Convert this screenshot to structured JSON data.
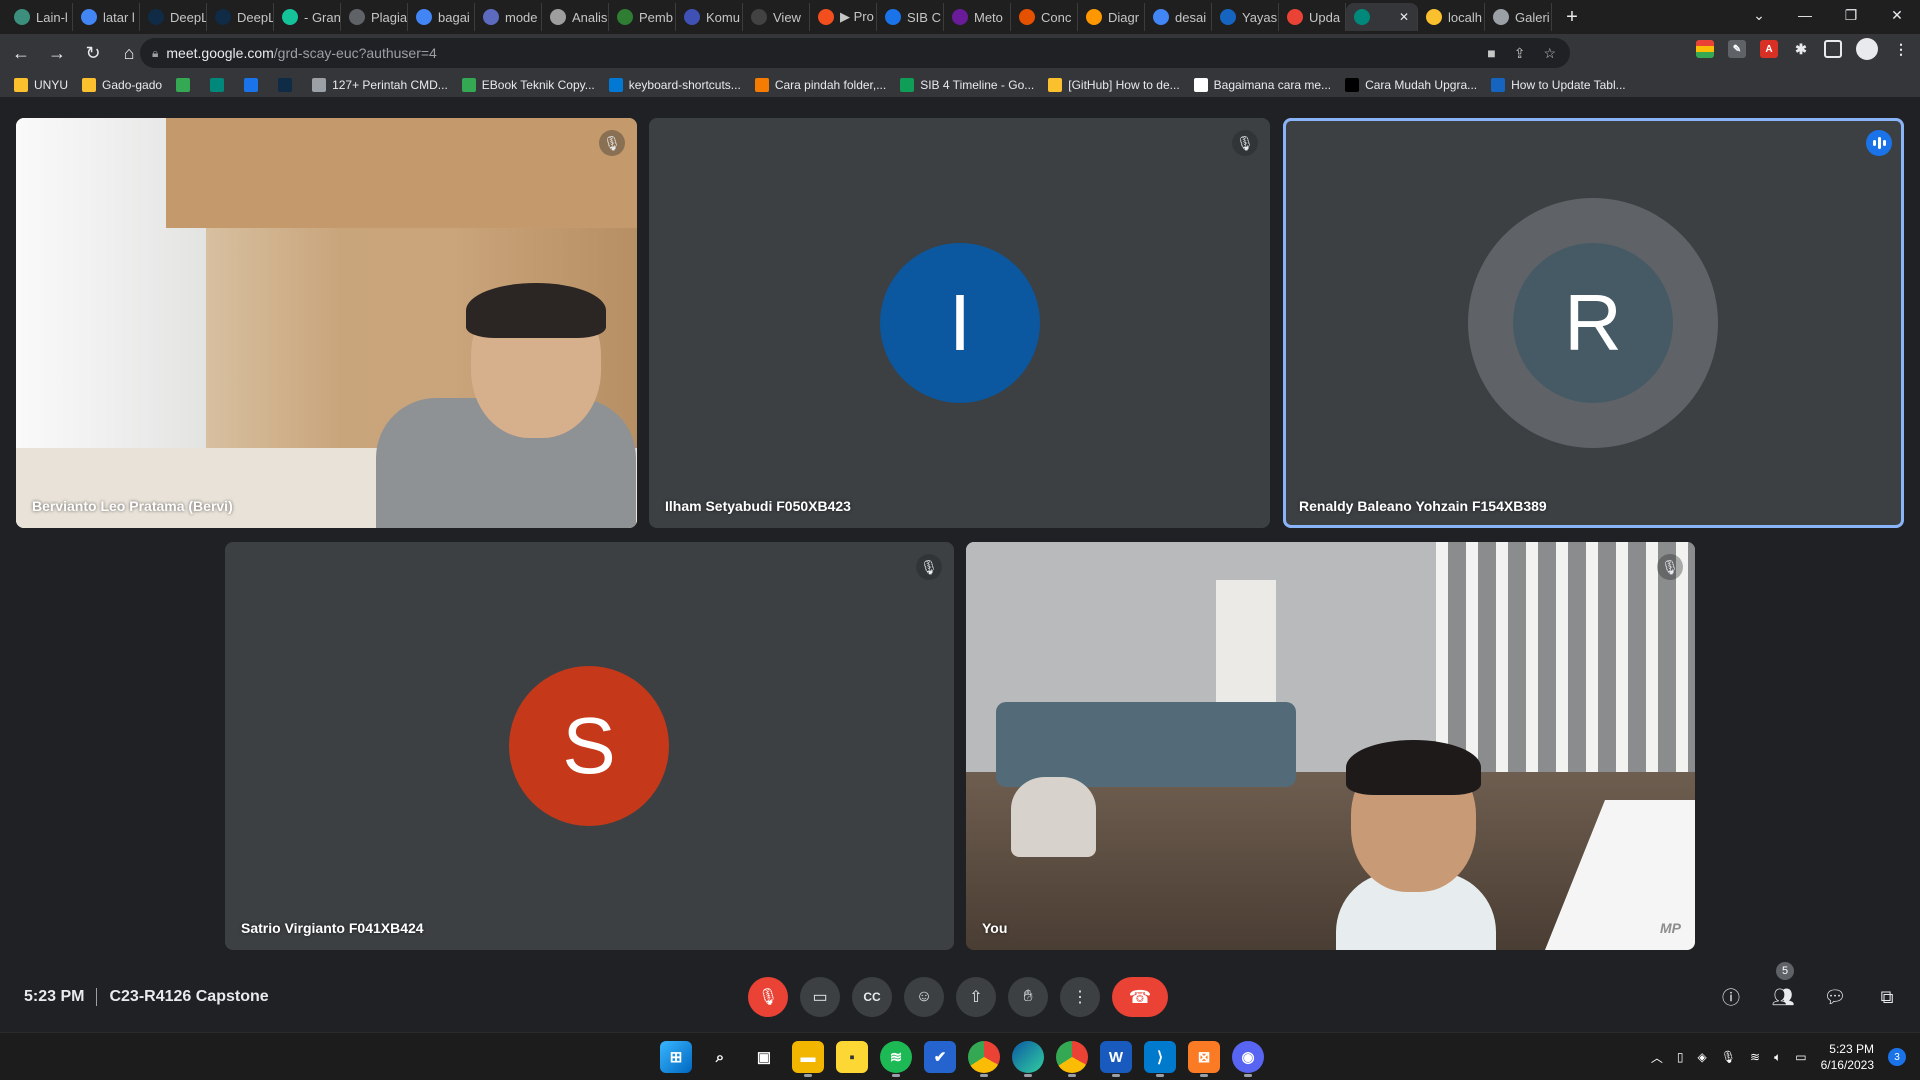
{
  "browser": {
    "tabs": [
      {
        "label": "Lain-l",
        "color": "#3c8f7c"
      },
      {
        "label": "latar l",
        "color": "#4285f4"
      },
      {
        "label": "DeepL",
        "color": "#0f2b46"
      },
      {
        "label": "DeepL",
        "color": "#0f2b46"
      },
      {
        "label": "- Gran",
        "color": "#15c39a"
      },
      {
        "label": "Plagia",
        "color": "#5f6368"
      },
      {
        "label": "bagai",
        "color": "#4285f4"
      },
      {
        "label": "mode",
        "color": "#5c6bc0"
      },
      {
        "label": "Analis",
        "color": "#9e9e9e"
      },
      {
        "label": "Pemb",
        "color": "#2e7d32"
      },
      {
        "label": "Komu",
        "color": "#3f51b5"
      },
      {
        "label": "View",
        "color": "#424242"
      },
      {
        "label": "▶ Pro",
        "color": "#f24e1e"
      },
      {
        "label": "SIB C",
        "color": "#1a73e8"
      },
      {
        "label": "Meto",
        "color": "#6a1b9a"
      },
      {
        "label": "Conc",
        "color": "#e65100"
      },
      {
        "label": "Diagr",
        "color": "#ff9800"
      },
      {
        "label": "desai",
        "color": "#4285f4"
      },
      {
        "label": "Yayas",
        "color": "#1565c0"
      },
      {
        "label": "Upda",
        "color": "#ea4335"
      },
      {
        "label": "",
        "color": "#00897b",
        "active": true
      },
      {
        "label": "localh",
        "color": "#fbc02d"
      },
      {
        "label": "Galeri",
        "color": "#9aa0a6"
      }
    ],
    "url_host": "meet.google.com",
    "url_path": "/grd-scay-euc?authuser=4",
    "bookmarks": [
      {
        "label": "UNYU",
        "color": "#fbc02d"
      },
      {
        "label": "Gado-gado",
        "color": "#fbc02d"
      },
      {
        "label": "",
        "color": "#34a853"
      },
      {
        "label": "",
        "color": "#00897b"
      },
      {
        "label": "",
        "color": "#1a73e8"
      },
      {
        "label": "",
        "color": "#0f2b46"
      },
      {
        "label": "127+ Perintah CMD...",
        "color": "#9aa0a6"
      },
      {
        "label": "EBook Teknik Copy...",
        "color": "#34a853"
      },
      {
        "label": "keyboard-shortcuts...",
        "color": "#0078d4"
      },
      {
        "label": "Cara pindah folder,...",
        "color": "#f57c00"
      },
      {
        "label": "SIB 4 Timeline - Go...",
        "color": "#0f9d58"
      },
      {
        "label": "[GitHub] How to de...",
        "color": "#fbc02d"
      },
      {
        "label": "Bagaimana cara me...",
        "color": "#ffffff"
      },
      {
        "label": "Cara Mudah Upgra...",
        "color": "#000000"
      },
      {
        "label": "How to Update Tabl...",
        "color": "#1565c0"
      }
    ]
  },
  "meeting": {
    "time": "5:23 PM",
    "title": "C23-R4126 Capstone",
    "participants_count": "5",
    "tiles": [
      {
        "name": "Bervianto Leo Pratama (Bervi)",
        "type": "video"
      },
      {
        "name": "Ilham Setyabudi F050XB423",
        "initial": "I",
        "avatar_color": "#0b57a0"
      },
      {
        "name": "Renaldy Baleano Yohzain F154XB389",
        "initial": "R",
        "avatar_color": "#455a64",
        "speaking": true
      },
      {
        "name": "Satrio Virgianto F041XB424",
        "initial": "S",
        "avatar_color": "#c5391a"
      },
      {
        "name": "You",
        "type": "video",
        "watermark": "MP"
      }
    ]
  },
  "taskbar": {
    "time": "5:23 PM",
    "date": "6/16/2023",
    "notification_count": "3"
  },
  "colors": {
    "speaking_border": "#8ab4f8",
    "end_call": "#ea4335",
    "tile_bg": "#3c4043"
  }
}
